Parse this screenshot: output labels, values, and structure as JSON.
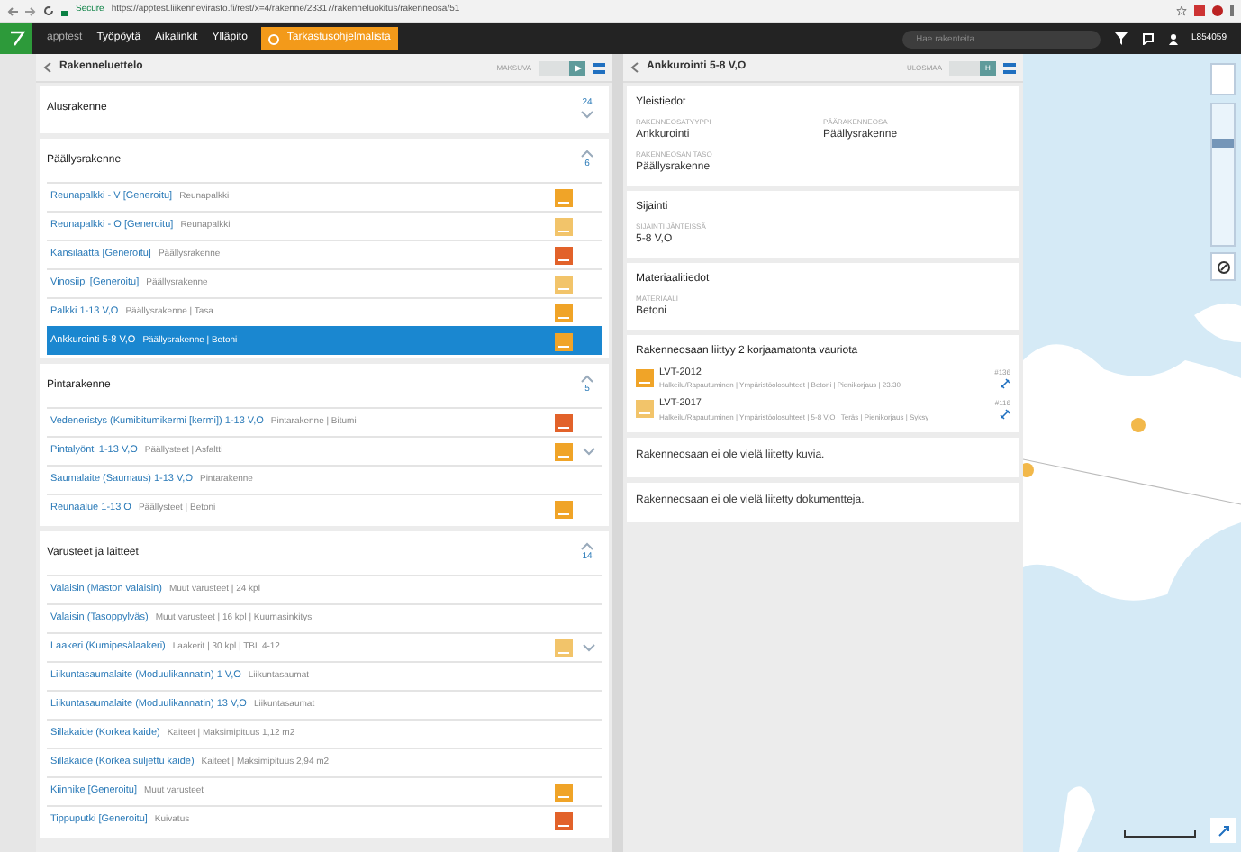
{
  "browser": {
    "secure_label": "Secure",
    "url": "https://apptest.liikennevirasto.fi/rest/x=4/rakenne/23317/rakenneluokitus/rakenneosa/51"
  },
  "nav": {
    "brand": "apptest",
    "items": [
      {
        "label": "Työpöytä"
      },
      {
        "label": "Aikalinkit"
      },
      {
        "label": "Ylläpito"
      }
    ],
    "alert_button": "Tarkastusohjelmalista",
    "search": {
      "placeholder": "Hae rakenteita..."
    },
    "user": "L854059"
  },
  "left_panel": {
    "title": "Rakenneluettelo",
    "mode_label": "MAKSUVA",
    "sections": [
      {
        "title": "Alusrakenne",
        "count": "24",
        "expanded": false
      },
      {
        "title": "Päällysrakenne",
        "count": "6",
        "expanded": true,
        "items": [
          {
            "name": "Reunapalkki - V [Generoitu]",
            "detail": "Reunapalkki",
            "color": "#f0a428",
            "selected": false,
            "expandable": false
          },
          {
            "name": "Reunapalkki - O [Generoitu]",
            "detail": "Reunapalkki",
            "color": "#f2c46a",
            "selected": false,
            "expandable": false
          },
          {
            "name": "Kansilaatta [Generoitu]",
            "detail": "Päällysrakenne",
            "color": "#e2622a",
            "selected": false,
            "expandable": false
          },
          {
            "name": "Vinosiipi [Generoitu]",
            "detail": "Päällysrakenne",
            "color": "#f2c46a",
            "selected": false,
            "expandable": false
          },
          {
            "name": "Palkki 1-13 V,O",
            "detail": "Päällysrakenne | Tasa",
            "color": "#f0a428",
            "selected": false,
            "expandable": false
          },
          {
            "name": "Ankkurointi 5-8 V,O",
            "detail": "Päällysrakenne | Betoni",
            "color": "#f0a428",
            "selected": true,
            "expandable": false
          }
        ]
      },
      {
        "title": "Pintarakenne",
        "count": "5",
        "expanded": true,
        "items": [
          {
            "name": "Vedeneristys (Kumibitumikermi [kermi]) 1-13 V,O",
            "detail": "Pintarakenne | Bitumi",
            "color": "#e2622a",
            "selected": false,
            "expandable": false
          },
          {
            "name": "Pintalyönti 1-13 V,O",
            "detail": "Päällysteet | Asfaltti",
            "color": "#f0a428",
            "selected": false,
            "expandable": true
          },
          {
            "name": "Saumalaite (Saumaus) 1-13 V,O",
            "detail": "Pintarakenne",
            "selected": false,
            "expandable": false
          },
          {
            "name": "Reunaalue 1-13 O",
            "detail": "Päällysteet | Betoni",
            "color": "#f0a428",
            "selected": false,
            "expandable": false
          }
        ]
      },
      {
        "title": "Varusteet ja laitteet",
        "count": "14",
        "expanded": true,
        "items": [
          {
            "name": "Valaisin (Maston valaisin)",
            "detail": "Muut varusteet | 24 kpl",
            "selected": false,
            "expandable": false
          },
          {
            "name": "Valaisin (Tasoppylväs)",
            "detail": "Muut varusteet | 16 kpl | Kuumasinkitys",
            "selected": false,
            "expandable": false
          },
          {
            "name": "Laakeri (Kumipesälaakeri)",
            "detail": "Laakerit | 30 kpl | TBL 4-12",
            "color": "#f2c46a",
            "selected": false,
            "expandable": true
          },
          {
            "name": "Liikuntasaumalaite (Moduulikannatin) 1 V,O",
            "detail": "Liikuntasaumat",
            "selected": false,
            "expandable": false
          },
          {
            "name": "Liikuntasaumalaite (Moduulikannatin) 13 V,O",
            "detail": "Liikuntasaumat",
            "selected": false,
            "expandable": false
          },
          {
            "name": "Sillakaide (Korkea kaide)",
            "detail": "Kaiteet | Maksimipituus 1,12 m2",
            "selected": false,
            "expandable": false
          },
          {
            "name": "Sillakaide (Korkea suljettu kaide)",
            "detail": "Kaiteet | Maksimipituus 2,94 m2",
            "selected": false,
            "expandable": false
          },
          {
            "name": "Kiinnike [Generoitu]",
            "detail": "Muut varusteet",
            "color": "#f0a428",
            "selected": false,
            "expandable": false
          },
          {
            "name": "Tippuputki [Generoitu]",
            "detail": "Kuivatus",
            "color": "#e2622a",
            "selected": false,
            "expandable": false
          }
        ]
      }
    ]
  },
  "right_panel": {
    "title": "Ankkurointi 5-8 V,O",
    "mode_label": "ULOSMAA",
    "mode_button": "H",
    "cards": [
      {
        "title": "Yleistiedot",
        "fields": [
          {
            "label": "RAKENNEOSATYYPPI",
            "value": "Ankkurointi"
          },
          {
            "label": "PÄÄRAKENNEOSA",
            "value": "Päällysrakenne"
          },
          {
            "label": "RAKENNEOSAN TASO",
            "value": "Päällysrakenne"
          }
        ]
      },
      {
        "title": "Sijainti",
        "fields": [
          {
            "label": "SIJAINTI JÄNTEISSÄ",
            "value": "5-8 V,O"
          }
        ]
      },
      {
        "title": "Materiaalitiedot",
        "fields": [
          {
            "label": "MATERIAALI",
            "value": "Betoni"
          }
        ]
      }
    ],
    "damages": {
      "title": "Rakenneosaan liittyy 2 korjaamatonta vauriota",
      "items": [
        {
          "code": "LVT-2012",
          "detail": "Halkeilu/Rapautuminen | Ympäristöolosuhteet | Betoni | Pienikorjaus | 23.30",
          "number": "#136",
          "color": "#f0a428"
        },
        {
          "code": "LVT-2017",
          "detail": "Halkeilu/Rapautuminen | Ympäristöolosuhteet | 5-8 V,O | Teräs | Pienikorjaus | Syksy",
          "number": "#116",
          "color": "#f2c46a"
        }
      ]
    },
    "notes": [
      "Rakenneosaan ei ole vielä liitetty kuvia.",
      "Rakenneosaan ei ole vielä liitetty dokumentteja."
    ]
  },
  "map": {
    "zoom": {
      "level": 0.75
    }
  }
}
